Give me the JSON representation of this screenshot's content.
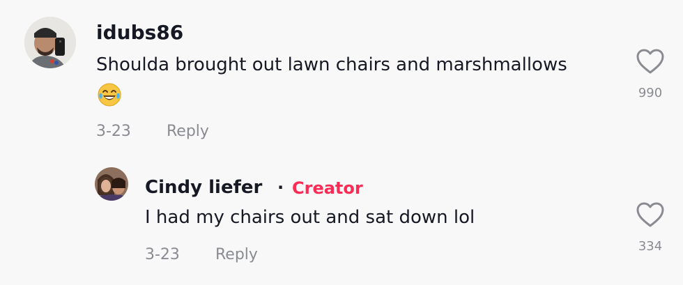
{
  "comment": {
    "username": "idubs86",
    "text": "Shoulda brought out lawn chairs and marshmallows",
    "emoji": "😂",
    "date": "3-23",
    "reply_label": "Reply",
    "like_count": "990"
  },
  "reply": {
    "username": "Cindy liefer",
    "separator": "·",
    "badge": "Creator",
    "text": "I had my chairs out and sat down lol",
    "date": "3-23",
    "reply_label": "Reply",
    "like_count": "334"
  },
  "colors": {
    "creator_badge": "#fe2c55",
    "muted_text": "#8a8b91",
    "background": "#f8f8f8"
  }
}
